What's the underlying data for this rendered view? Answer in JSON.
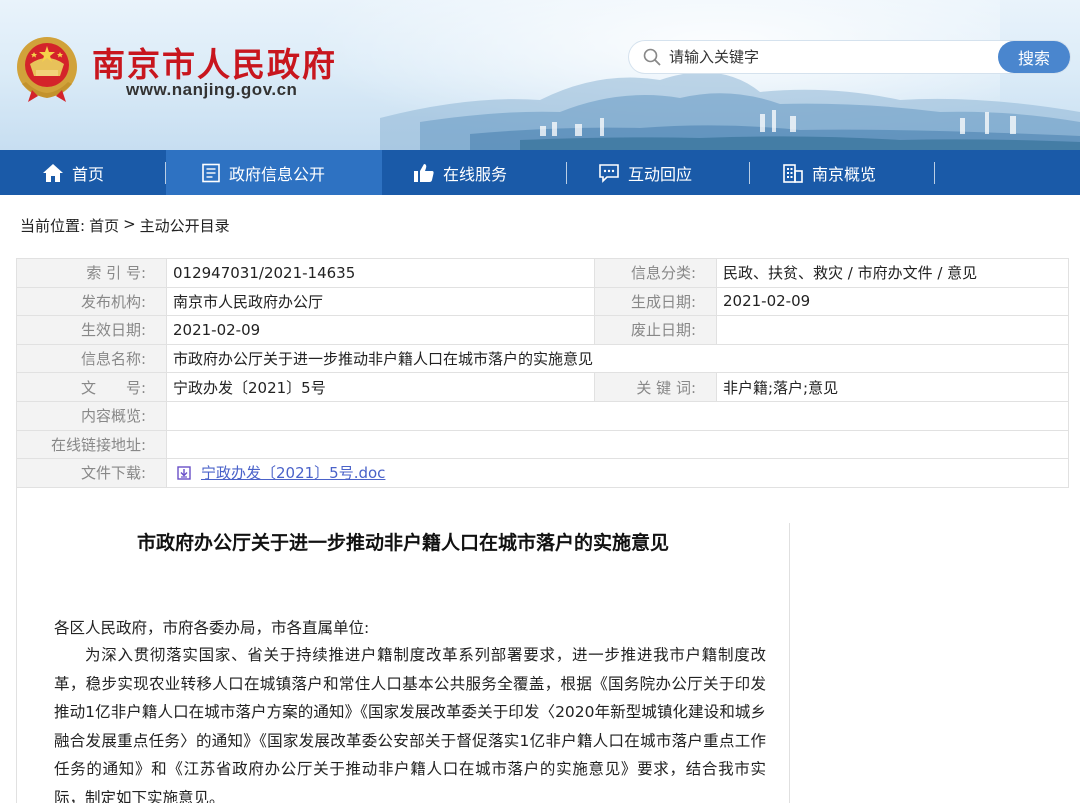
{
  "header": {
    "site_title": "南京市人民政府",
    "site_url": "www.nanjing.gov.cn",
    "emblem_icon": "national-emblem-icon",
    "search": {
      "placeholder": "请输入关键字",
      "button_label": "搜索",
      "icon": "search-icon"
    }
  },
  "nav": {
    "items": [
      {
        "label": "首页",
        "icon": "home-icon",
        "active": false
      },
      {
        "label": "政府信息公开",
        "icon": "document-icon",
        "active": true
      },
      {
        "label": "在线服务",
        "icon": "thumbs-up-icon",
        "active": false
      },
      {
        "label": "互动回应",
        "icon": "chat-icon",
        "active": false
      },
      {
        "label": "南京概览",
        "icon": "building-icon",
        "active": false
      }
    ]
  },
  "breadcrumb": {
    "prefix": "当前位置:",
    "items": [
      "首页",
      ">",
      "主动公开目录"
    ]
  },
  "info": {
    "index_label": "索 引 号:",
    "index_value": "012947031/2021-14635",
    "category_label": "信息分类:",
    "category_value": "民政、扶贫、救灾 / 市府办文件 / 意见",
    "publisher_label": "发布机构:",
    "publisher_value": "南京市人民政府办公厅",
    "created_label": "生成日期:",
    "created_value": "2021-02-09",
    "effective_label": "生效日期:",
    "effective_value": "2021-02-09",
    "repeal_label": "废止日期:",
    "repeal_value": "",
    "name_label": "信息名称:",
    "name_value": "市政府办公厅关于进一步推动非户籍人口在城市落户的实施意见",
    "docno_label": "文　　号:",
    "docno_value": "宁政办发〔2021〕5号",
    "keywords_label": "关 键 词:",
    "keywords_value": "非户籍;落户;意见",
    "summary_label": "内容概览:",
    "summary_value": "",
    "link_label": "在线链接地址:",
    "link_value": "",
    "download_label": "文件下载:",
    "download_value": "宁政办发〔2021〕5号.doc"
  },
  "article": {
    "title": "市政府办公厅关于进一步推动非户籍人口在城市落户的实施意见",
    "salutation": "各区人民政府，市府各委办局，市各直属单位:",
    "paragraph": "为深入贯彻落实国家、省关于持续推进户籍制度改革系列部署要求，进一步推进我市户籍制度改革，稳步实现农业转移人口在城镇落户和常住人口基本公共服务全覆盖，根据《国务院办公厅关于印发推动1亿非户籍人口在城市落户方案的通知》《国家发展改革委关于印发〈2020年新型城镇化建设和城乡融合发展重点任务〉的通知》《国家发展改革委公安部关于督促落实1亿非户籍人口在城市落户重点工作任务的通知》和《江苏省政府办公厅关于推动非户籍人口在城市落户的实施意见》要求，结合我市实际，制定如下实施意见。"
  },
  "colors": {
    "brand_red": "#c8161e",
    "nav_blue": "#1a5aa8",
    "nav_active": "#2e72c2",
    "search_button": "#4a86ce",
    "link": "#4a62c9"
  }
}
